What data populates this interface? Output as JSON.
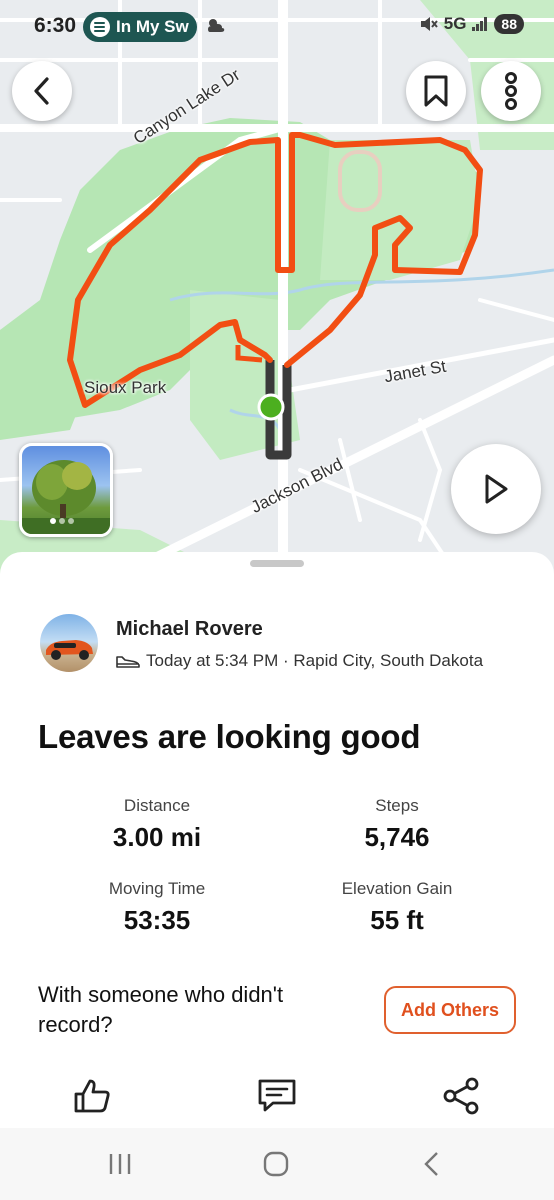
{
  "status_bar": {
    "time": "6:30",
    "media_pill": "In My Sw",
    "network": "5G",
    "battery": "88"
  },
  "map": {
    "labels": {
      "canyon_lake": "Canyon Lake Dr",
      "sioux_park": "Sioux Park",
      "janet": "Janet St",
      "jackson": "Jackson Blvd"
    },
    "route_color": "#f24e13",
    "overlap_color": "#3a3a3a",
    "park_color": "#b6e6b4",
    "start_marker_color": "#4caf1f"
  },
  "activity": {
    "athlete": "Michael Rovere",
    "meta": "Today at 5:34 PM · Rapid City, South Dakota",
    "title": "Leaves are looking good",
    "stats": {
      "distance": {
        "label": "Distance",
        "value": "3.00 mi"
      },
      "steps": {
        "label": "Steps",
        "value": "5,746"
      },
      "moving_time": {
        "label": "Moving Time",
        "value": "53:35"
      },
      "elevation_gain": {
        "label": "Elevation Gain",
        "value": "55 ft"
      }
    },
    "prompt": "With someone who didn't record?",
    "add_others": "Add Others",
    "accent_color": "#e0501e"
  },
  "icons": {
    "back": "chevron-left-icon",
    "bookmark": "bookmark-icon",
    "more": "vertical-dots-icon",
    "play": "play-icon",
    "kudos": "thumbs-up-icon",
    "comment": "comment-icon",
    "share": "share-icon",
    "shoe": "shoe-icon",
    "recents": "recents-icon",
    "home": "home-icon",
    "nav_back": "back-icon"
  }
}
